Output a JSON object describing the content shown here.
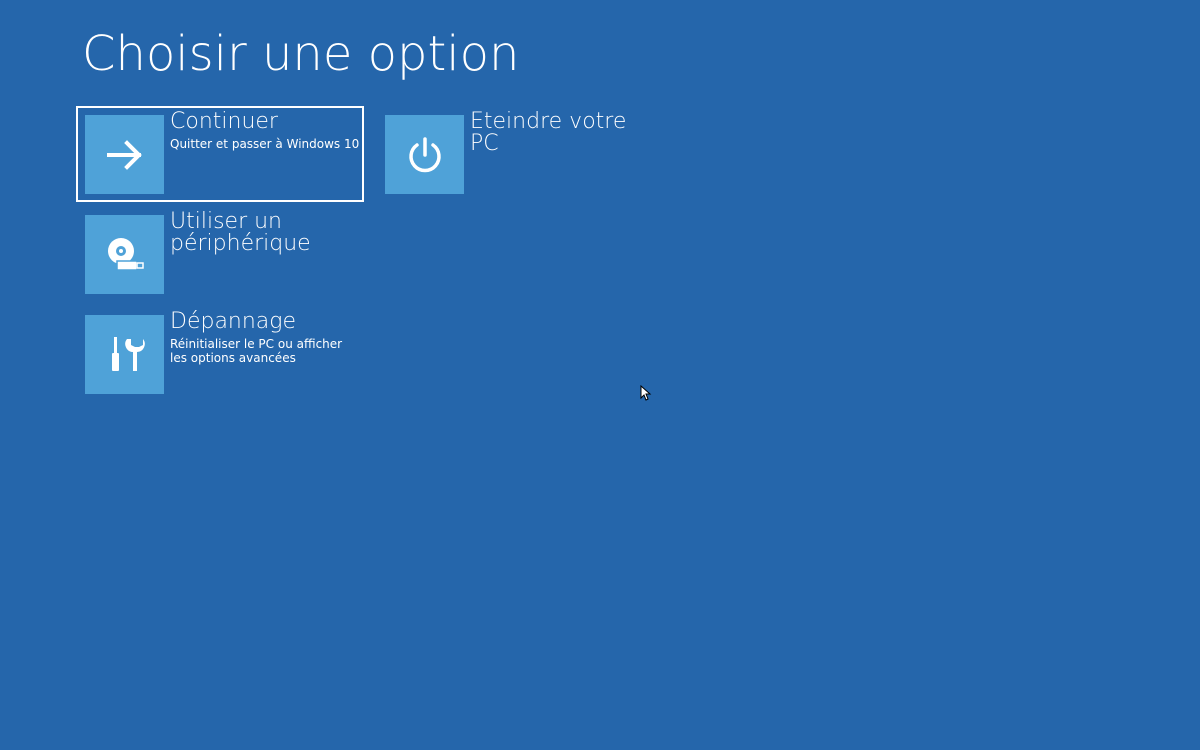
{
  "page": {
    "title": "Choisir une option",
    "background_color": "#2566ab",
    "tile_color": "#4fa2d8"
  },
  "options": [
    {
      "id": "continue",
      "label": "Continuer",
      "description": "Quitter et passer à Windows 10",
      "icon": "arrow-right-icon",
      "selected": true
    },
    {
      "id": "shutdown",
      "label": "Eteindre votre PC",
      "description": "",
      "icon": "power-icon",
      "selected": false
    },
    {
      "id": "device",
      "label": "Utiliser un périphérique",
      "description": "",
      "icon": "disc-usb-icon",
      "selected": false
    },
    {
      "id": "troubleshoot",
      "label": "Dépannage",
      "description": "Réinitialiser le PC ou afficher les options avancées",
      "icon": "tools-icon",
      "selected": false
    }
  ]
}
